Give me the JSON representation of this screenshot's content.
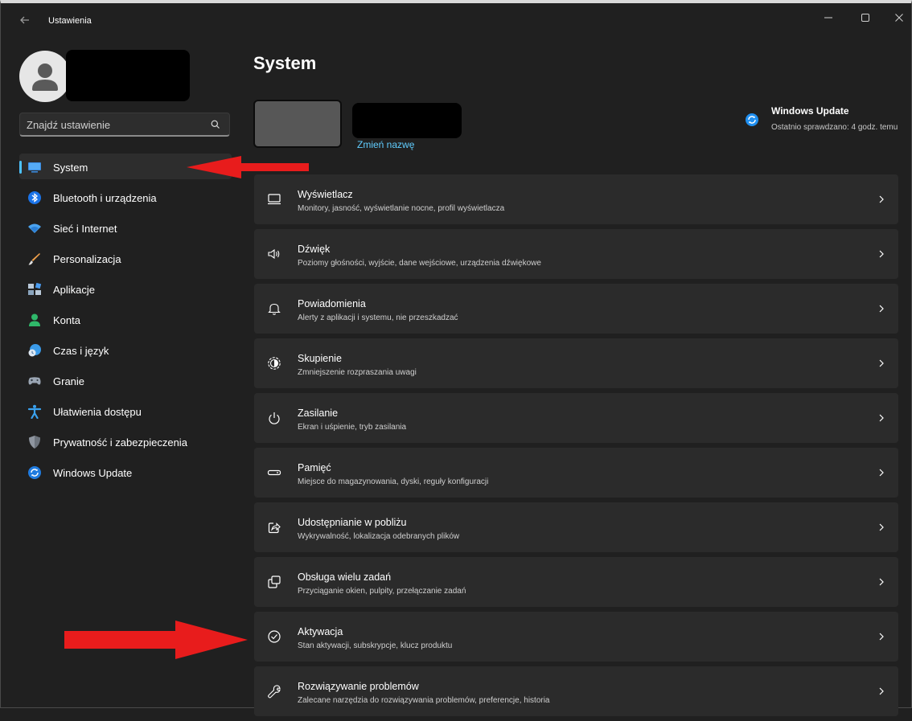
{
  "window": {
    "title": "Ustawienia",
    "back_icon": "back-arrow-icon",
    "controls": [
      "minimize-icon",
      "maximize-icon",
      "close-icon"
    ]
  },
  "search": {
    "placeholder": "Znajdź ustawienie",
    "icon": "search-icon"
  },
  "sidebar": {
    "items": [
      {
        "label": "System",
        "icon": "monitor-icon",
        "selected": true
      },
      {
        "label": "Bluetooth i urządzenia",
        "icon": "bluetooth-icon"
      },
      {
        "label": "Sieć i Internet",
        "icon": "wifi-icon"
      },
      {
        "label": "Personalizacja",
        "icon": "brush-icon"
      },
      {
        "label": "Aplikacje",
        "icon": "apps-icon"
      },
      {
        "label": "Konta",
        "icon": "person-icon"
      },
      {
        "label": "Czas i język",
        "icon": "globe-clock-icon"
      },
      {
        "label": "Granie",
        "icon": "gamepad-icon"
      },
      {
        "label": "Ułatwienia dostępu",
        "icon": "accessibility-icon"
      },
      {
        "label": "Prywatność i zabezpieczenia",
        "icon": "shield-icon"
      },
      {
        "label": "Windows Update",
        "icon": "update-icon"
      }
    ]
  },
  "main": {
    "title": "System",
    "device": {
      "rename_label": "Zmień nazwę"
    },
    "windows_update": {
      "title": "Windows Update",
      "subtitle": "Ostatnio sprawdzano: 4 godz. temu",
      "icon": "update-icon"
    },
    "cards": [
      {
        "title": "Wyświetlacz",
        "subtitle": "Monitory, jasność, wyświetlanie nocne, profil wyświetlacza",
        "icon": "display-icon"
      },
      {
        "title": "Dźwięk",
        "subtitle": "Poziomy głośności, wyjście, dane wejściowe, urządzenia dźwiękowe",
        "icon": "speaker-icon"
      },
      {
        "title": "Powiadomienia",
        "subtitle": "Alerty z aplikacji i systemu, nie przeszkadzać",
        "icon": "bell-icon"
      },
      {
        "title": "Skupienie",
        "subtitle": "Zmniejszenie rozpraszania uwagi",
        "icon": "focus-icon"
      },
      {
        "title": "Zasilanie",
        "subtitle": "Ekran i uśpienie, tryb zasilania",
        "icon": "power-icon"
      },
      {
        "title": "Pamięć",
        "subtitle": "Miejsce do magazynowania, dyski, reguły konfiguracji",
        "icon": "storage-icon"
      },
      {
        "title": "Udostępnianie w pobliżu",
        "subtitle": "Wykrywalność, lokalizacja odebranych plików",
        "icon": "share-icon"
      },
      {
        "title": "Obsługa wielu zadań",
        "subtitle": "Przyciąganie okien, pulpity, przełączanie zadań",
        "icon": "multitask-icon"
      },
      {
        "title": "Aktywacja",
        "subtitle": "Stan aktywacji, subskrypcje, klucz produktu",
        "icon": "check-circle-icon"
      },
      {
        "title": "Rozwiązywanie problemów",
        "subtitle": "Zalecane narzędzia do rozwiązywania problemów, preferencje, historia",
        "icon": "wrench-icon"
      }
    ]
  },
  "annotations": {
    "arrow_color": "#e81c1c",
    "accent": "#4cc2ff",
    "link_color": "#60cdff"
  }
}
